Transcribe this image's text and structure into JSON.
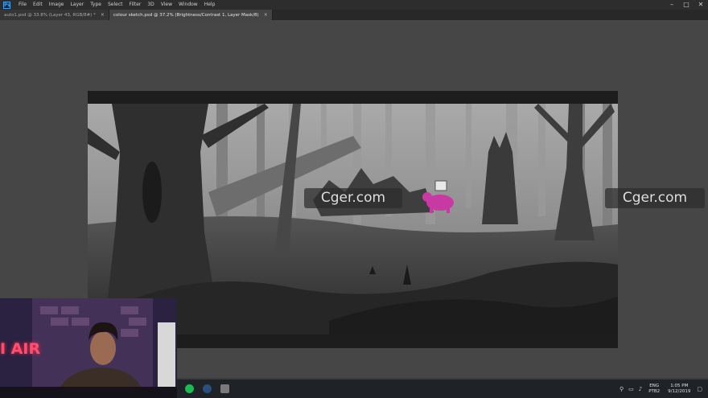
{
  "menubar": {
    "logo": "Ps",
    "items": [
      "File",
      "Edit",
      "Image",
      "Layer",
      "Type",
      "Select",
      "Filter",
      "3D",
      "View",
      "Window",
      "Help"
    ],
    "controls": [
      "–",
      "□",
      "✕"
    ]
  },
  "tabs": [
    {
      "label": "auto1.psd @ 33.8% (Layer 43, RGB/8#) *",
      "active": false,
      "close": "×"
    },
    {
      "label": "colour sketch.psd @ 37.2% (Brightness/Contrast 1, Layer Mask/8)",
      "active": true,
      "close": "×"
    }
  ],
  "watermarks": [
    "Cger.com",
    "Cger.com"
  ],
  "webcam": {
    "neon_text": "I AIR"
  },
  "taskbar": {
    "language": "ENG",
    "language_sub": "PTB2",
    "time": "1:05 PM",
    "date": "9/12/2019",
    "icons": [
      "spotify-icon",
      "steam-icon",
      "app-icon"
    ]
  },
  "colors": {
    "menubar": "#2d2d2d",
    "workspace": "#464646",
    "canvas_frame": "#1d1d1d",
    "taskbar": "#1f2328",
    "spotify": "#1db954",
    "creature": "#c83aa3"
  }
}
